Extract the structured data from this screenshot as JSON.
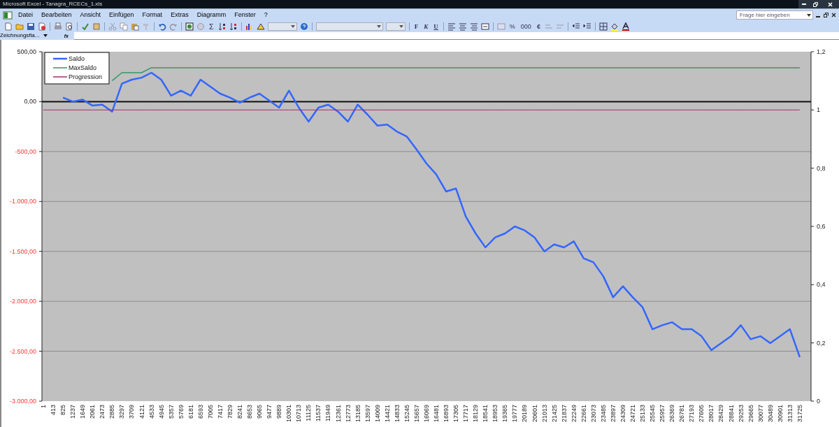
{
  "window": {
    "title": "Microsoft Excel - Tanagra_RCECs_1.xls"
  },
  "menu": [
    "Datei",
    "Bearbeiten",
    "Ansicht",
    "Einfügen",
    "Format",
    "Extras",
    "Diagramm",
    "Fenster",
    "?"
  ],
  "help_field": {
    "placeholder": "Frage hier eingeben"
  },
  "toolbar": {
    "sum": "Σ",
    "format_buttons": [
      "F",
      "K",
      "U"
    ],
    "number_buttons": [
      "%",
      "000",
      "€"
    ]
  },
  "formula_bar": {
    "name_box": "Zeichnungsfla...",
    "fx": "fx"
  },
  "chart": {
    "chart_data": {
      "type": "line",
      "categories": [
        "1",
        "413",
        "825",
        "1237",
        "1649",
        "2061",
        "2473",
        "2885",
        "3297",
        "3709",
        "4121",
        "4533",
        "4945",
        "5357",
        "5769",
        "6181",
        "6593",
        "7005",
        "7417",
        "7829",
        "8241",
        "8653",
        "9065",
        "9477",
        "9889",
        "10301",
        "10713",
        "11125",
        "11537",
        "11949",
        "12361",
        "12773",
        "13185",
        "13597",
        "14009",
        "14421",
        "14833",
        "15245",
        "15657",
        "16069",
        "16481",
        "16893",
        "17305",
        "17717",
        "18129",
        "18541",
        "18953",
        "19365",
        "19777",
        "20189",
        "20601",
        "21013",
        "21425",
        "21837",
        "22249",
        "22661",
        "23073",
        "23485",
        "23897",
        "24309",
        "24721",
        "25133",
        "25545",
        "25957",
        "26369",
        "26781",
        "27193",
        "27605",
        "28017",
        "28429",
        "28841",
        "29253",
        "29665",
        "30077",
        "30489",
        "30901",
        "31313",
        "31725"
      ],
      "series": [
        {
          "name": "Saldo",
          "color": "#3366ff",
          "values": [
            null,
            null,
            40,
            0,
            20,
            -40,
            -30,
            -100,
            180,
            220,
            240,
            290,
            220,
            60,
            110,
            60,
            220,
            150,
            80,
            40,
            -10,
            40,
            80,
            10,
            -60,
            110,
            -60,
            -200,
            -60,
            -30,
            -100,
            -200,
            -30,
            -130,
            -240,
            -230,
            -300,
            -350,
            -480,
            -620,
            -730,
            -900,
            -870,
            -1150,
            -1320,
            -1460,
            -1360,
            -1320,
            -1250,
            -1290,
            -1360,
            -1500,
            -1430,
            -1460,
            -1400,
            -1570,
            -1610,
            -1750,
            -1960,
            -1850,
            -1960,
            -2060,
            -2280,
            -2240,
            -2210,
            -2280,
            -2280,
            -2350,
            -2490,
            -2420,
            -2350,
            -2240,
            -2380,
            -2350,
            -2420,
            -2350,
            -2280,
            -2560
          ]
        },
        {
          "name": "MaxSaldo",
          "color": "#339966",
          "values": [
            null,
            null,
            null,
            null,
            null,
            null,
            null,
            210,
            290,
            290,
            290,
            340,
            340,
            340,
            340,
            340,
            340,
            340,
            340,
            340,
            340,
            340,
            340,
            340,
            340,
            340,
            340,
            340,
            340,
            340,
            340,
            340,
            340,
            340,
            340,
            340,
            340,
            340,
            340,
            340,
            340,
            340,
            340,
            340,
            340,
            340,
            340,
            340,
            340,
            340,
            340,
            340,
            340,
            340,
            340,
            340,
            340,
            340,
            340,
            340,
            340,
            340,
            340,
            340,
            340,
            340,
            340,
            340,
            340,
            340,
            340,
            340,
            340,
            340,
            340,
            340,
            340,
            340
          ]
        },
        {
          "name": "Progression",
          "color": "#993366",
          "axis": "y2",
          "values": [
            1,
            1,
            1,
            1,
            1,
            1,
            1,
            1,
            1,
            1,
            1,
            1,
            1,
            1,
            1,
            1,
            1,
            1,
            1,
            1,
            1,
            1,
            1,
            1,
            1,
            1,
            1,
            1,
            1,
            1,
            1,
            1,
            1,
            1,
            1,
            1,
            1,
            1,
            1,
            1,
            1,
            1,
            1,
            1,
            1,
            1,
            1,
            1,
            1,
            1,
            1,
            1,
            1,
            1,
            1,
            1,
            1,
            1,
            1,
            1,
            1,
            1,
            1,
            1,
            1,
            1,
            1,
            1,
            1,
            1,
            1,
            1,
            1,
            1,
            1,
            1,
            1,
            1
          ]
        }
      ],
      "ylim": [
        -3000,
        500
      ],
      "grid": true,
      "legend": true,
      "yticks": [
        {
          "value": 500,
          "label": "500,00"
        },
        {
          "value": 0,
          "label": "0,00"
        },
        {
          "value": -500,
          "label": "-500,00"
        },
        {
          "value": -1000,
          "label": "-1.000,00"
        },
        {
          "value": -1500,
          "label": "-1.500,00"
        },
        {
          "value": -2000,
          "label": "-2.000,00"
        },
        {
          "value": -2500,
          "label": "-2.500,00"
        },
        {
          "value": -3000,
          "label": "-3.000,00"
        }
      ],
      "y2lim": [
        0,
        1.2
      ],
      "y2ticks": [
        {
          "value": 1.2,
          "label": "1,2"
        },
        {
          "value": 1,
          "label": "1"
        },
        {
          "value": 0.8,
          "label": "0,8"
        },
        {
          "value": 0.6,
          "label": "0,6"
        },
        {
          "value": 0.4,
          "label": "0,4"
        },
        {
          "value": 0.2,
          "label": "0,2"
        },
        {
          "value": 0,
          "label": "0"
        }
      ]
    }
  }
}
